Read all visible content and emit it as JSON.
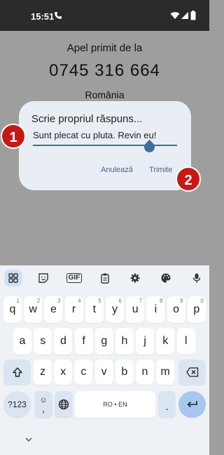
{
  "status": {
    "time": "15:51"
  },
  "call": {
    "label": "Apel primit de la",
    "number": "0745 316 664",
    "country": "România"
  },
  "dialog": {
    "title": "Scrie propriul răspuns...",
    "input_value": "Sunt plecat cu pluta. Revin eu!",
    "cancel_label": "Anulează",
    "send_label": "Trimite"
  },
  "badges": {
    "one": "1",
    "two": "2"
  },
  "keyboard": {
    "toolbar": [
      "grid-icon",
      "sticker-icon",
      "GIF",
      "clipboard-icon",
      "gear-icon",
      "palette-icon",
      "mic-icon"
    ],
    "gif_label": "GIF",
    "row1": [
      {
        "k": "q",
        "h": "1"
      },
      {
        "k": "w",
        "h": "2"
      },
      {
        "k": "e",
        "h": "3"
      },
      {
        "k": "r",
        "h": "4"
      },
      {
        "k": "t",
        "h": "5"
      },
      {
        "k": "y",
        "h": "6"
      },
      {
        "k": "u",
        "h": "7"
      },
      {
        "k": "i",
        "h": "8"
      },
      {
        "k": "o",
        "h": "9"
      },
      {
        "k": "p",
        "h": "0"
      }
    ],
    "row2": [
      "a",
      "s",
      "d",
      "f",
      "g",
      "h",
      "j",
      "k",
      "l"
    ],
    "row3": [
      "z",
      "x",
      "c",
      "v",
      "b",
      "n",
      "m"
    ],
    "symbols_label": "?123",
    "emoji_label": "☺",
    "comma_label": ",",
    "space_label": "RO • EN",
    "period_label": "."
  },
  "colors": {
    "accent": "#3f6f9a",
    "badge": "#c41a17",
    "enter_key": "#a8c7ef"
  }
}
